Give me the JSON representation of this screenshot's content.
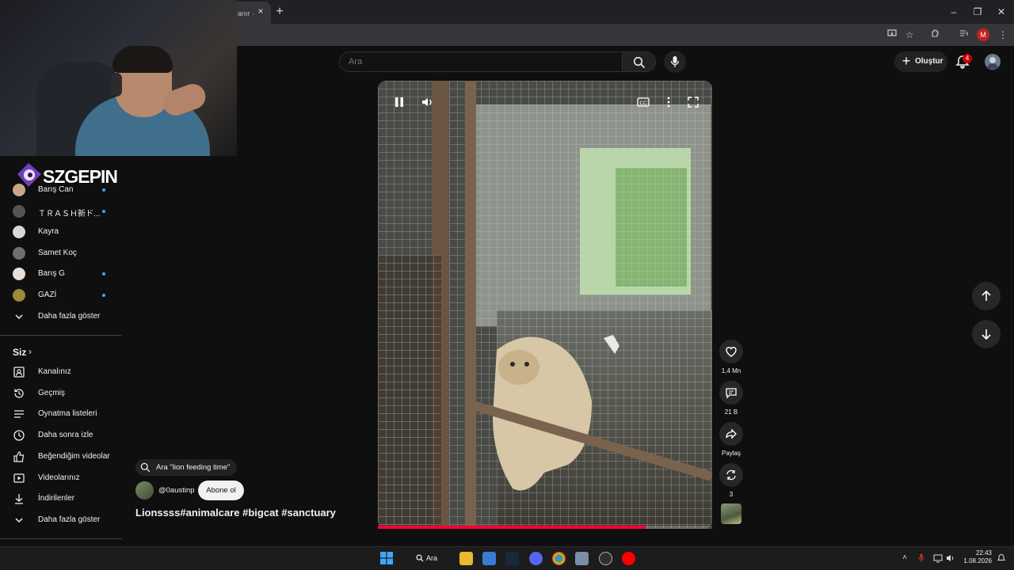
{
  "browser": {
    "tab_title": "anır ·",
    "tab_close": "×",
    "new_tab": "+",
    "window_controls": [
      "–",
      "❐",
      "✕"
    ],
    "profile_initial": "M"
  },
  "header": {
    "search_placeholder": "Ara",
    "create_label": "Oluştur",
    "notification_count": "4"
  },
  "overlay": {
    "logo_text": "SZGEPIN"
  },
  "sidebar": {
    "subscriptions": [
      {
        "label": "Barış Can",
        "dot": true,
        "color": "#c9a88a"
      },
      {
        "label": "ＴＲＡＳＨ新ド...",
        "dot": true,
        "color": "#555555"
      },
      {
        "label": "Kayra",
        "dot": false,
        "color": "#d8d8d8"
      },
      {
        "label": "Samet Koç",
        "dot": false,
        "color": "#6f6f6f"
      },
      {
        "label": "Barış G",
        "dot": true,
        "color": "#e8e0d8"
      },
      {
        "label": "GAZİ",
        "dot": true,
        "color": "#9a8a3a"
      }
    ],
    "show_more_1": "Daha fazla göster",
    "you_title": "Siz",
    "you_items": [
      {
        "label": "Kanalınız",
        "icon": "channel-icon"
      },
      {
        "label": "Geçmiş",
        "icon": "history-icon"
      },
      {
        "label": "Oynatma listeleri",
        "icon": "playlists-icon"
      },
      {
        "label": "Daha sonra izle",
        "icon": "watch-later-icon"
      },
      {
        "label": "Beğendiğim videolar",
        "icon": "like-icon"
      },
      {
        "label": "Videolarınız",
        "icon": "your-videos-icon"
      },
      {
        "label": "İndirilenler",
        "icon": "downloads-icon"
      }
    ],
    "show_more_2": "Daha fazla göster"
  },
  "short": {
    "related_search": "Ara \"lion feeding time\"",
    "channel": "@0austinp",
    "subscribe_label": "Abone ol",
    "title": "Lionssss#animalcare #bigcat #sanctuary",
    "progress_fraction": 0.8,
    "likes": "1,4 Mn",
    "comments": "21 B",
    "share_label": "Paylaş",
    "remix_count": "3"
  },
  "taskbar": {
    "search_label": "Ara",
    "time": "22:43",
    "date": "1.08.2026"
  }
}
